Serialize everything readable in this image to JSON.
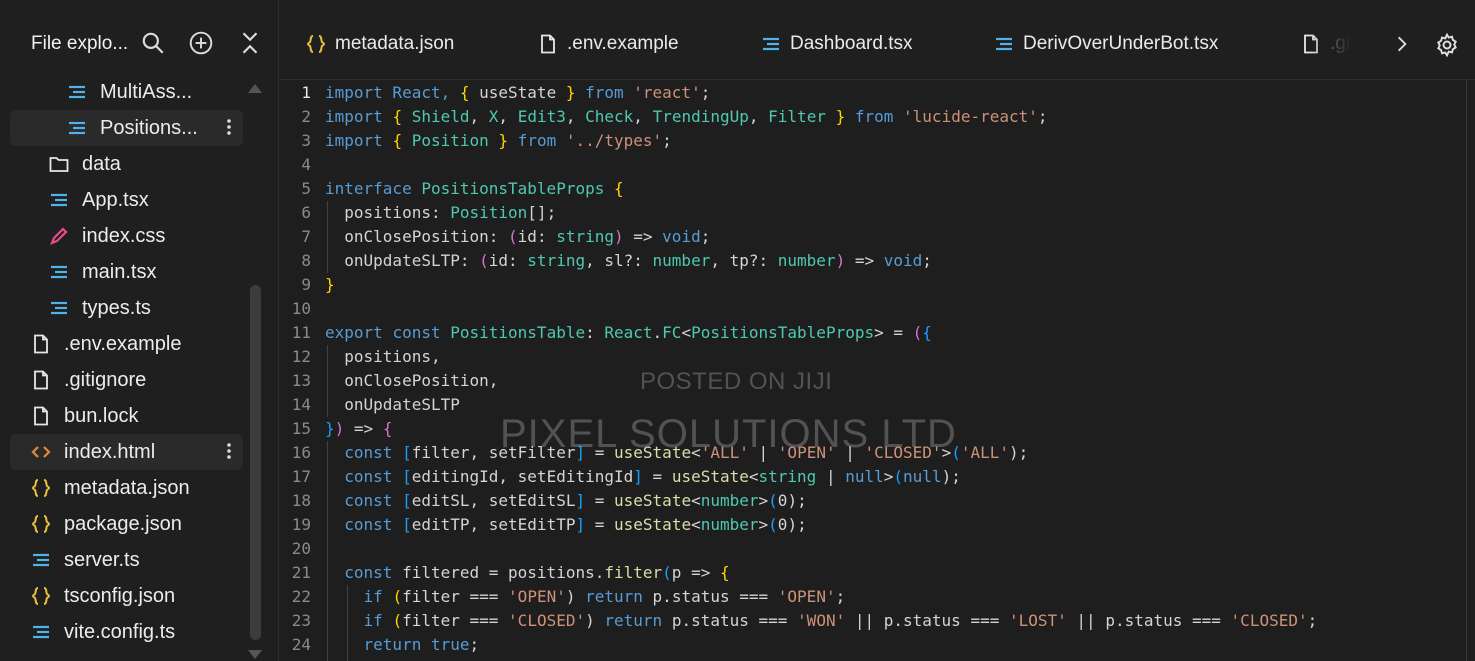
{
  "sidebar": {
    "title": "File explo...",
    "items": [
      {
        "label": "MultiAss...",
        "icon": "lines-icon",
        "level": 2
      },
      {
        "label": "Positions...",
        "icon": "lines-icon",
        "level": 2,
        "selected": true
      },
      {
        "label": "data",
        "icon": "folder-icon",
        "level": 1
      },
      {
        "label": "App.tsx",
        "icon": "lines-icon",
        "level": 1
      },
      {
        "label": "index.css",
        "icon": "pencil-icon",
        "level": 1
      },
      {
        "label": "main.tsx",
        "icon": "lines-icon",
        "level": 1
      },
      {
        "label": "types.ts",
        "icon": "lines-icon",
        "level": 1
      },
      {
        "label": ".env.example",
        "icon": "file-icon",
        "level": 0
      },
      {
        "label": ".gitignore",
        "icon": "file-icon",
        "level": 0
      },
      {
        "label": "bun.lock",
        "icon": "file-icon",
        "level": 0
      },
      {
        "label": "index.html",
        "icon": "code-icon",
        "level": 0,
        "selected": true
      },
      {
        "label": "metadata.json",
        "icon": "braces-icon",
        "level": 0
      },
      {
        "label": "package.json",
        "icon": "braces-icon",
        "level": 0
      },
      {
        "label": "server.ts",
        "icon": "lines-icon",
        "level": 0
      },
      {
        "label": "tsconfig.json",
        "icon": "braces-icon",
        "level": 0
      },
      {
        "label": "vite.config.ts",
        "icon": "lines-icon",
        "level": 0
      }
    ]
  },
  "tabs": [
    {
      "label": "metadata.json",
      "icon": "braces-icon"
    },
    {
      "label": ".env.example",
      "icon": "file-icon"
    },
    {
      "label": "Dashboard.tsx",
      "icon": "lines-icon"
    },
    {
      "label": "DerivOverUnderBot.tsx",
      "icon": "lines-icon"
    },
    {
      "label": ".gitig",
      "icon": "file-icon"
    }
  ],
  "editor": {
    "line_numbers": [
      "1",
      "2",
      "3",
      "4",
      "5",
      "6",
      "7",
      "8",
      "9",
      "10",
      "11",
      "12",
      "13",
      "14",
      "15",
      "16",
      "17",
      "18",
      "19",
      "20",
      "21",
      "22",
      "23",
      "24"
    ],
    "lines": [
      [
        "import React, ",
        "{",
        " useState ",
        "}",
        " from ",
        "'react'",
        ";"
      ],
      [
        "import ",
        "{",
        " Shield",
        ", ",
        "X",
        ", ",
        "Edit3",
        ", ",
        "Check",
        ", ",
        "TrendingUp",
        ", ",
        "Filter",
        " ",
        "}",
        " from ",
        "'lucide-react'",
        ";"
      ],
      [
        "import ",
        "{",
        " Position ",
        "}",
        " from ",
        "'../types'",
        ";"
      ],
      [
        ""
      ],
      [
        "interface ",
        "PositionsTableProps",
        " ",
        "{"
      ],
      [
        "  positions: ",
        "Position",
        "[];"
      ],
      [
        "  onClosePosition: ",
        "(",
        "id: ",
        "string",
        ")",
        " => ",
        "void",
        ";"
      ],
      [
        "  onUpdateSLTP: ",
        "(",
        "id: ",
        "string",
        ", sl?: ",
        "number",
        ", tp?: ",
        "number",
        ")",
        " => ",
        "void",
        ";"
      ],
      [
        "}"
      ],
      [
        ""
      ],
      [
        "export ",
        "const ",
        "PositionsTable",
        ": ",
        "React",
        ".",
        "FC",
        "<",
        "PositionsTableProps",
        "> = ",
        "(",
        "{"
      ],
      [
        "  positions,"
      ],
      [
        "  onClosePosition,"
      ],
      [
        "  onUpdateSLTP"
      ],
      [
        "}",
        ")",
        " => ",
        "{"
      ],
      [
        "  ",
        "const ",
        "[",
        "filter, setFilter",
        "]",
        " = ",
        "useState",
        "<",
        "'ALL'",
        " | ",
        "'OPEN'",
        " | ",
        "'CLOSED'",
        ">",
        "(",
        "'ALL'",
        ");"
      ],
      [
        "  ",
        "const ",
        "[",
        "editingId, setEditingId",
        "]",
        " = ",
        "useState",
        "<",
        "string",
        " | ",
        "null",
        ">",
        "(",
        "null",
        ");"
      ],
      [
        "  ",
        "const ",
        "[",
        "editSL, setEditSL",
        "]",
        " = ",
        "useState",
        "<",
        "number",
        ">",
        "(",
        "0",
        ");"
      ],
      [
        "  ",
        "const ",
        "[",
        "editTP, setEditTP",
        "]",
        " = ",
        "useState",
        "<",
        "number",
        ">",
        "(",
        "0",
        ");"
      ],
      [
        ""
      ],
      [
        "  ",
        "const ",
        "filtered = positions.",
        "filter",
        "(",
        "p => ",
        "{"
      ],
      [
        "    ",
        "if ",
        "(",
        "filter === ",
        "'OPEN'",
        ") ",
        "return ",
        "p.status === ",
        "'OPEN'",
        ";"
      ],
      [
        "    ",
        "if ",
        "(",
        "filter === ",
        "'CLOSED'",
        ") ",
        "return ",
        "p.status === ",
        "'WON'",
        " || p.status === ",
        "'LOST'",
        " || p.status === ",
        "'CLOSED'",
        ";"
      ],
      [
        "    ",
        "return ",
        "true",
        ";"
      ]
    ],
    "classes": [
      [
        "kw",
        "br1",
        "id",
        "br1",
        "kw",
        "str",
        "id"
      ],
      [
        "kw",
        "br1",
        "ty",
        "id",
        "ty",
        "id",
        "ty",
        "id",
        "ty",
        "id",
        "gr",
        "id",
        "ty",
        "id",
        "br1",
        "kw",
        "str",
        "id"
      ],
      [
        "kw",
        "br1",
        "ty",
        "br1",
        "kw",
        "str",
        "id"
      ],
      [
        "id"
      ],
      [
        "kw",
        "ty",
        "id",
        "br1"
      ],
      [
        "id",
        "ty",
        "id"
      ],
      [
        "id",
        "br2",
        "id",
        "ty",
        "br2",
        "id",
        "kw",
        "id"
      ],
      [
        "id",
        "br2",
        "id",
        "ty",
        "id",
        "ty",
        "id",
        "ty",
        "br2",
        "id",
        "kw",
        "id"
      ],
      [
        "br1"
      ],
      [
        "id"
      ],
      [
        "kw",
        "kw",
        "ty",
        "id",
        "ty",
        "id",
        "ty",
        "id",
        "ty",
        "id",
        "br2",
        "br3"
      ],
      [
        "id"
      ],
      [
        "id"
      ],
      [
        "id"
      ],
      [
        "br3",
        "br2",
        "id",
        "br2"
      ],
      [
        "id",
        "kw",
        "br3",
        "id",
        "br3",
        "id",
        "fn",
        "id",
        "str",
        "id",
        "str",
        "id",
        "str",
        "id",
        "br3",
        "str",
        "id"
      ],
      [
        "id",
        "kw",
        "br3",
        "id",
        "br3",
        "id",
        "fn",
        "id",
        "ty",
        "id",
        "kw",
        "id",
        "br3",
        "kw",
        "id"
      ],
      [
        "id",
        "kw",
        "br3",
        "id",
        "br3",
        "id",
        "fn",
        "id",
        "ty",
        "id",
        "br3",
        "id",
        "id"
      ],
      [
        "id",
        "kw",
        "br3",
        "id",
        "br3",
        "id",
        "fn",
        "id",
        "ty",
        "id",
        "br3",
        "id",
        "id"
      ],
      [
        "id"
      ],
      [
        "id",
        "kw",
        "id",
        "fn",
        "br3",
        "id",
        "br1"
      ],
      [
        "id",
        "kw",
        "br1",
        "id",
        "str",
        "id",
        "kw",
        "id",
        "str",
        "id"
      ],
      [
        "id",
        "kw",
        "br1",
        "id",
        "str",
        "id",
        "kw",
        "id",
        "str",
        "id",
        "str",
        "id",
        "str",
        "id"
      ],
      [
        "id",
        "kw",
        "kw",
        "id"
      ]
    ],
    "active_line": "1"
  },
  "watermark": {
    "line1": "POSTED ON JIJI",
    "line2": "PIXEL SOLUTIONS LTD"
  },
  "colors": {
    "keyword": "#569cd6",
    "string": "#ce9178",
    "type": "#4ec9b0",
    "function": "#dcdcaa",
    "icon_blue": "#4fb2e8",
    "icon_yellow": "#e8c23a",
    "icon_orange": "#e08a3c",
    "icon_pink": "#e64d8a"
  }
}
